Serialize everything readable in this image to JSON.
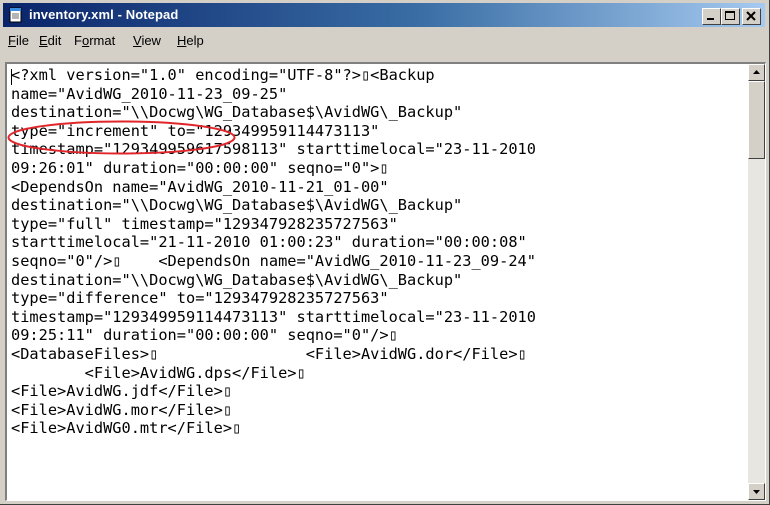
{
  "window": {
    "title": "inventory.xml - Notepad",
    "controls": {
      "minimize": "minimize",
      "maximize": "maximize",
      "close": "close"
    }
  },
  "menu": [
    {
      "label": "File",
      "accel": "F",
      "rest": "ile"
    },
    {
      "label": "Edit",
      "accel": "E",
      "rest": "dit"
    },
    {
      "label": "Format",
      "pre": "F",
      "accel": "o",
      "rest": "rmat"
    },
    {
      "label": "View",
      "accel": "V",
      "rest": "iew"
    },
    {
      "label": "Help",
      "accel": "H",
      "rest": "elp"
    }
  ],
  "document": {
    "lines": [
      "<?xml version=\"1.0\" encoding=\"UTF-8\"?>▯<Backup",
      "name=\"AvidWG_2010-11-23_09-25\"",
      "destination=\"\\\\Docwg\\WG_Database$\\AvidWG\\_Backup\"",
      "type=\"increment\" to=\"129349959114473113\"",
      "timestamp=\"129349959617598113\" starttimelocal=\"23-11-2010",
      "09:26:01\" duration=\"00:00:00\" seqno=\"0\">▯",
      "<DependsOn name=\"AvidWG_2010-11-21_01-00\"",
      "destination=\"\\\\Docwg\\WG_Database$\\AvidWG\\_Backup\"",
      "type=\"full\" timestamp=\"129347928235727563\"",
      "starttimelocal=\"21-11-2010 01:00:23\" duration=\"00:00:08\"",
      "seqno=\"0\"/>▯    <DependsOn name=\"AvidWG_2010-11-23_09-24\"",
      "destination=\"\\\\Docwg\\WG_Database$\\AvidWG\\_Backup\"",
      "type=\"difference\" to=\"129347928235727563\"",
      "timestamp=\"129349959114473113\" starttimelocal=\"23-11-2010",
      "09:25:11\" duration=\"00:00:00\" seqno=\"0\"/>▯",
      "<DatabaseFiles>▯                <File>AvidWG.dor</File>▯",
      "        <File>AvidWG.dps</File>▯",
      "<File>AvidWG.jdf</File>▯",
      "<File>AvidWG.mor</File>▯",
      "<File>AvidWG0.mtr</File>▯",
      "",
      "",
      ""
    ],
    "highlight_color": "#e0262a"
  },
  "colors": {
    "titlebar_start": "#0a246a",
    "titlebar_end": "#a6caf0",
    "chrome": "#d4d0c8",
    "annotation": "#e0262a"
  }
}
